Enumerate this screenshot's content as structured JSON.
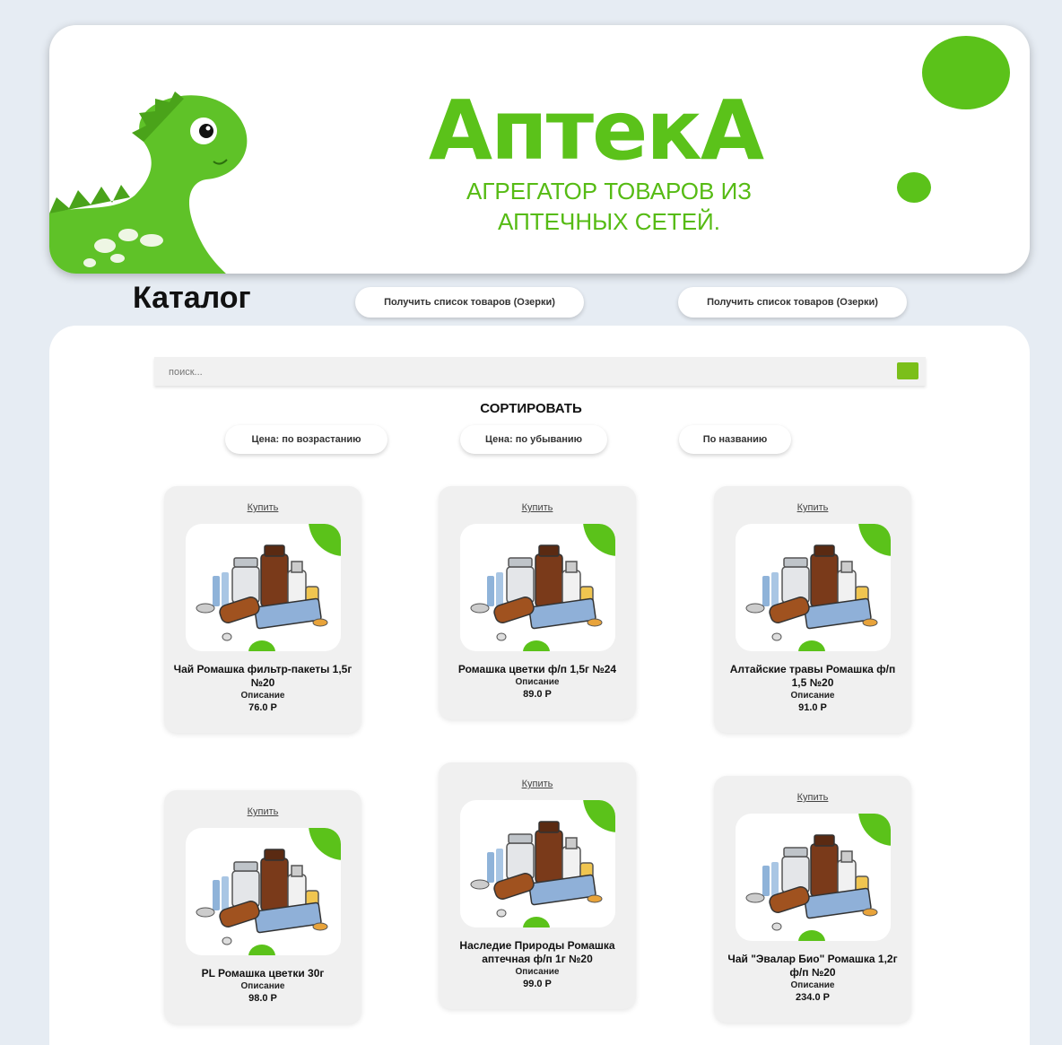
{
  "header": {
    "brand_title": "АптекА",
    "brand_subtitle_line1": "АГРЕГАТОР ТОВАРОВ ИЗ",
    "brand_subtitle_line2": "АПТЕЧНЫХ СЕТЕЙ."
  },
  "catalog": {
    "title": "Каталог",
    "fetch_button_1": "Получить список товаров (Озерки)",
    "fetch_button_2": "Получить список товаров (Озерки)"
  },
  "search": {
    "placeholder": "поиск..."
  },
  "sort": {
    "title": "СОРТИРОВАТЬ",
    "price_asc": "Цена: по возрастанию",
    "price_desc": "Цена: по убыванию",
    "by_name": "По названию"
  },
  "products": [
    {
      "buy": "Купить",
      "name": "Чай Ромашка фильтр-пакеты 1,5г №20",
      "desc": "Описание",
      "price": "76.0 Р"
    },
    {
      "buy": "Купить",
      "name": "Ромашка цветки ф/п 1,5г №24",
      "desc": "Описание",
      "price": "89.0 Р"
    },
    {
      "buy": "Купить",
      "name": "Алтайские травы Ромашка ф/п 1,5 №20",
      "desc": "Описание",
      "price": "91.0 Р"
    },
    {
      "buy": "Купить",
      "name": "PL Ромашка цветки 30г",
      "desc": "Описание",
      "price": "98.0 Р"
    },
    {
      "buy": "Купить",
      "name": "Наследие Природы Ромашка аптечная ф/п 1г №20",
      "desc": "Описание",
      "price": "99.0 Р"
    },
    {
      "buy": "Купить",
      "name": "Чай \"Эвалар Био\" Ромашка 1,2г ф/п №20",
      "desc": "Описание",
      "price": "234.0 Р"
    }
  ],
  "colors": {
    "accent": "#5bc21a",
    "background": "#e6ecf3"
  }
}
